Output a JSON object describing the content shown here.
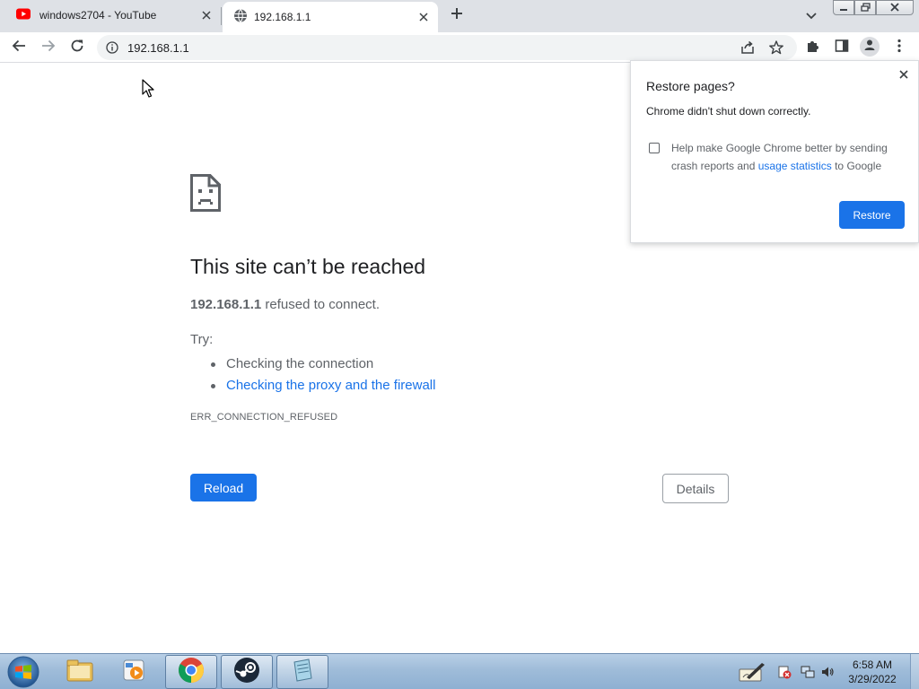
{
  "tabs": [
    {
      "title": "windows2704 - YouTube",
      "favicon": "youtube-icon",
      "active": false
    },
    {
      "title": "192.168.1.1",
      "favicon": "globe-icon",
      "active": true
    }
  ],
  "toolbar": {
    "url": "192.168.1.1"
  },
  "error_page": {
    "title": "This site can’t be reached",
    "host": "192.168.1.1",
    "message": " refused to connect.",
    "try_label": "Try:",
    "suggestions": [
      {
        "text": "Checking the connection",
        "link": false
      },
      {
        "text": "Checking the proxy and the firewall",
        "link": true
      }
    ],
    "error_code": "ERR_CONNECTION_REFUSED",
    "reload_label": "Reload",
    "details_label": "Details"
  },
  "restore_bubble": {
    "title": "Restore pages?",
    "message": "Chrome didn't shut down correctly.",
    "checkbox_text_before": "Help make Google Chrome better by sending crash reports and ",
    "checkbox_link": "usage statistics",
    "checkbox_text_after": " to Google",
    "checkbox_checked": false,
    "restore_label": "Restore"
  },
  "taskbar": {
    "pinned": [
      {
        "name": "file-explorer-icon",
        "active": false
      },
      {
        "name": "media-player-icon",
        "active": false
      },
      {
        "name": "chrome-icon",
        "active": true
      },
      {
        "name": "steam-icon",
        "active": true
      },
      {
        "name": "notepad-icon",
        "active": true
      }
    ],
    "clock_time": "6:58 AM",
    "clock_date": "3/29/2022"
  },
  "colors": {
    "accent": "#1a73e8",
    "tabstrip_bg": "#dee1e6",
    "text_primary": "#202124",
    "text_secondary": "#5f6368"
  }
}
